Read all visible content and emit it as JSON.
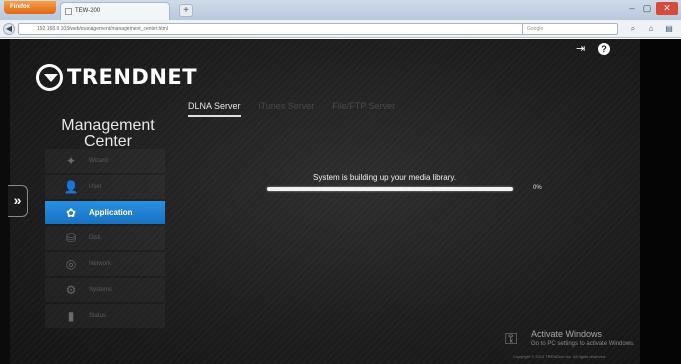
{
  "browser": {
    "menu_button": "Firefox",
    "tab_title": "TEW-200",
    "new_tab": "+",
    "url": "192.168.0.103/web/management/management_center.html",
    "search_placeholder": "Google",
    "back_arrow": "◀",
    "win_min": "–",
    "win_max": "▢",
    "win_close": "✕"
  },
  "app": {
    "brand": "TRENDNET",
    "title_line1": "Management",
    "title_line2": "Center",
    "expand_arrow": "»",
    "sidebar": [
      {
        "label": "Wizard",
        "icon": "wand-icon",
        "glyph": "✦",
        "active": false
      },
      {
        "label": "User",
        "icon": "user-icon",
        "glyph": "👤",
        "active": false
      },
      {
        "label": "Application",
        "icon": "puzzle-icon",
        "glyph": "✿",
        "active": true
      },
      {
        "label": "Disk",
        "icon": "disk-icon",
        "glyph": "⛁",
        "active": false
      },
      {
        "label": "Network",
        "icon": "globe-icon",
        "glyph": "◎",
        "active": false
      },
      {
        "label": "Systems",
        "icon": "gears-icon",
        "glyph": "⚙",
        "active": false
      },
      {
        "label": "Status",
        "icon": "bars-icon",
        "glyph": "▮",
        "active": false
      }
    ],
    "tabs": [
      {
        "label": "DLNA Server",
        "active": true
      },
      {
        "label": "iTunes Server",
        "active": false
      },
      {
        "label": "File/FTP Server",
        "active": false
      }
    ],
    "status_message": "System is building up your media library.",
    "progress_percent": "0%",
    "progress_value": 0
  },
  "watermark": {
    "title": "Activate Windows",
    "subtitle": "Go to PC settings to activate Windows.",
    "copyright": "Copyright © 2013 TRENDnet Inc. All rights reserved."
  }
}
